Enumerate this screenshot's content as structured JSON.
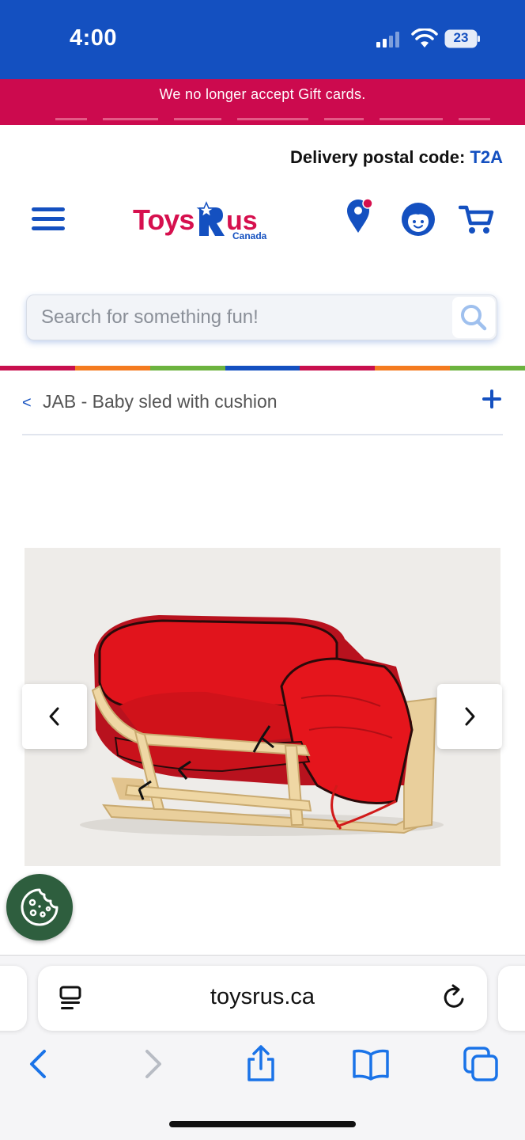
{
  "status_bar": {
    "time": "4:00",
    "battery": "23"
  },
  "promo": {
    "message": "We no longer accept Gift cards."
  },
  "delivery": {
    "label": "Delivery postal code:",
    "code": "T2A"
  },
  "header": {
    "logo_text": "ToysRus",
    "logo_sub": "Canada",
    "icons": [
      "menu-icon",
      "store-locator-icon",
      "account-icon",
      "cart-icon"
    ]
  },
  "search": {
    "placeholder": "Search for something fun!",
    "value": ""
  },
  "stripe_colors": [
    "#c8104e",
    "#f47b20",
    "#6cb33f",
    "#1450c0",
    "#c8104e",
    "#f47b20",
    "#6cb33f"
  ],
  "breadcrumb": {
    "back": "<",
    "title": "JAB - Baby sled with cushion"
  },
  "product": {
    "image_alt": "Red cushioned baby sled on wooden runners"
  },
  "browser": {
    "url": "toysrus.ca"
  },
  "colors": {
    "brand_blue": "#1450c0",
    "banner_red": "#cc0a4e",
    "cookie_green": "#2e5e3e"
  }
}
